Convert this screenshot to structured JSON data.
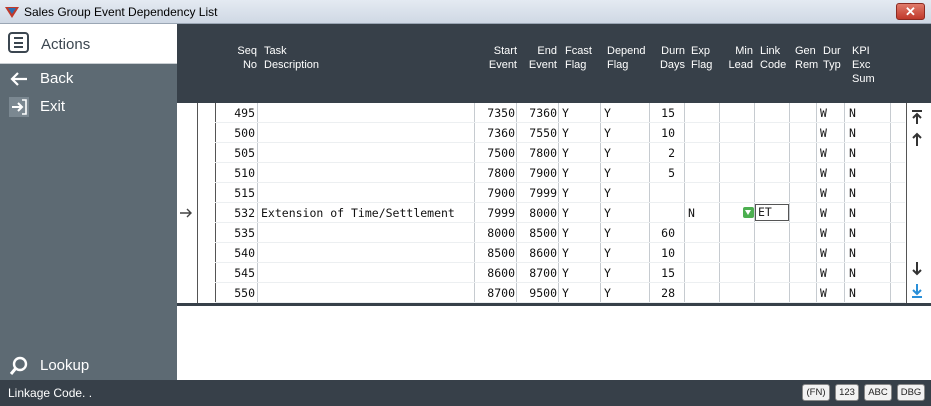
{
  "window": {
    "title": "Sales Group Event Dependency List",
    "close_label": "✕"
  },
  "sidebar": {
    "actions_label": "Actions",
    "items": [
      {
        "label": "Back",
        "icon": "back-arrow-icon"
      },
      {
        "label": "Exit",
        "icon": "exit-icon"
      }
    ],
    "lookup_label": "Lookup"
  },
  "columns": {
    "seq": [
      "Seq",
      "No"
    ],
    "task": [
      "Task",
      "Description"
    ],
    "start": [
      "Start",
      "Event"
    ],
    "end": [
      "End",
      "Event"
    ],
    "fcast": [
      "Fcast",
      "Flag"
    ],
    "depend": [
      "Depend",
      "Flag"
    ],
    "durn": [
      "Durn",
      "Days"
    ],
    "exp": [
      "Exp",
      "Flag"
    ],
    "min": [
      "Min",
      "Lead"
    ],
    "link": [
      "Link",
      "Code"
    ],
    "gen": [
      "Gen",
      "Rem"
    ],
    "dur": [
      "Dur",
      "Typ"
    ],
    "kpi": [
      "KPI",
      "Exc",
      "Sum"
    ]
  },
  "rows": [
    {
      "seq": "495",
      "task": "",
      "start": "7350",
      "end": "7360",
      "fcast": "Y",
      "depend": "Y",
      "durn": "15",
      "exp": "",
      "lead": false,
      "link": "",
      "durtyp": "W",
      "kpi": "N"
    },
    {
      "seq": "500",
      "task": "",
      "start": "7360",
      "end": "7550",
      "fcast": "Y",
      "depend": "Y",
      "durn": "10",
      "exp": "",
      "lead": false,
      "link": "",
      "durtyp": "W",
      "kpi": "N"
    },
    {
      "seq": "505",
      "task": "",
      "start": "7500",
      "end": "7800",
      "fcast": "Y",
      "depend": "Y",
      "durn": "2",
      "exp": "",
      "lead": false,
      "link": "",
      "durtyp": "W",
      "kpi": "N"
    },
    {
      "seq": "510",
      "task": "",
      "start": "7800",
      "end": "7900",
      "fcast": "Y",
      "depend": "Y",
      "durn": "5",
      "exp": "",
      "lead": false,
      "link": "",
      "durtyp": "W",
      "kpi": "N"
    },
    {
      "seq": "515",
      "task": "",
      "start": "7900",
      "end": "7999",
      "fcast": "Y",
      "depend": "Y",
      "durn": "",
      "exp": "",
      "lead": false,
      "link": "",
      "durtyp": "W",
      "kpi": "N"
    },
    {
      "seq": "532",
      "task": "Extension of Time/Settlement",
      "start": "7999",
      "end": "8000",
      "fcast": "Y",
      "depend": "Y",
      "durn": "",
      "exp": "N",
      "lead": true,
      "link": "ET",
      "durtyp": "W",
      "kpi": "N"
    },
    {
      "seq": "535",
      "task": "",
      "start": "8000",
      "end": "8500",
      "fcast": "Y",
      "depend": "Y",
      "durn": "60",
      "exp": "",
      "lead": false,
      "link": "",
      "durtyp": "W",
      "kpi": "N"
    },
    {
      "seq": "540",
      "task": "",
      "start": "8500",
      "end": "8600",
      "fcast": "Y",
      "depend": "Y",
      "durn": "10",
      "exp": "",
      "lead": false,
      "link": "",
      "durtyp": "W",
      "kpi": "N"
    },
    {
      "seq": "545",
      "task": "",
      "start": "8600",
      "end": "8700",
      "fcast": "Y",
      "depend": "Y",
      "durn": "15",
      "exp": "",
      "lead": false,
      "link": "",
      "durtyp": "W",
      "kpi": "N"
    },
    {
      "seq": "550",
      "task": "",
      "start": "8700",
      "end": "9500",
      "fcast": "Y",
      "depend": "Y",
      "durn": "28",
      "exp": "",
      "lead": false,
      "link": "",
      "durtyp": "W",
      "kpi": "N"
    }
  ],
  "selected_row": 5,
  "status": {
    "message": "Linkage Code. .",
    "buttons": [
      "(FN)",
      "123",
      "ABC",
      "DBG"
    ]
  }
}
